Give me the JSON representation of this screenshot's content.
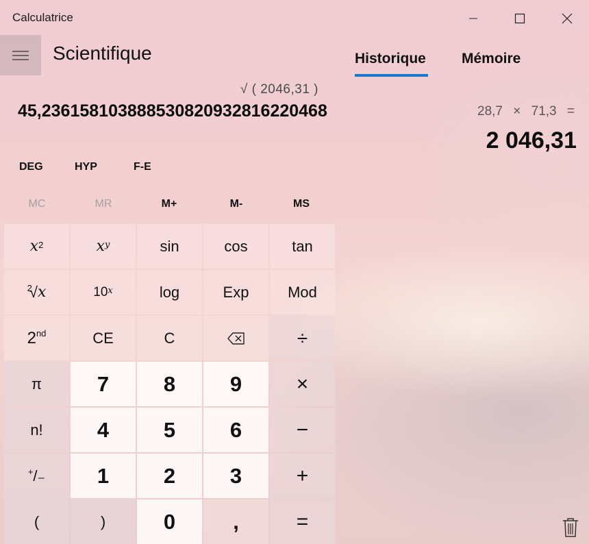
{
  "window": {
    "title": "Calculatrice",
    "minimize_icon": "minimize-icon",
    "maximize_icon": "maximize-icon",
    "close_icon": "close-icon"
  },
  "header": {
    "menu_icon": "hamburger-icon",
    "mode": "Scientifique"
  },
  "display": {
    "expression": "√ ( 2046,31 )",
    "result": "45,236158103888530820932816220468"
  },
  "angle_row": {
    "deg": "DEG",
    "hyp": "HYP",
    "fe": "F-E"
  },
  "memory": {
    "mc": "MC",
    "mr": "MR",
    "mplus": "M+",
    "mminus": "M-",
    "ms": "MS"
  },
  "keys": {
    "square": {
      "base": "x",
      "exp": "2"
    },
    "power": {
      "base": "x",
      "exp": "y"
    },
    "sin": "sin",
    "cos": "cos",
    "tan": "tan",
    "sqrt": {
      "index": "2",
      "radical": "√",
      "base": "x"
    },
    "ten_power": {
      "base": "10",
      "exp": "x"
    },
    "log": "log",
    "exp": "Exp",
    "mod": "Mod",
    "second": {
      "base": "2",
      "exp": "nd"
    },
    "ce": "CE",
    "c": "C",
    "backspace_icon": "backspace-icon",
    "divide": "÷",
    "pi": "π",
    "seven": "7",
    "eight": "8",
    "nine": "9",
    "multiply": "×",
    "factorial": "n!",
    "four": "4",
    "five": "5",
    "six": "6",
    "minus": "−",
    "negate": {
      "plus": "+",
      "minus": "/₋"
    },
    "one": "1",
    "two": "2",
    "three": "3",
    "plus": "+",
    "open_paren": "(",
    "close_paren": ")",
    "zero": "0",
    "decimal": ",",
    "equals": "="
  },
  "panel": {
    "tab_history": "Historique",
    "tab_memory": "Mémoire",
    "active_tab": "Historique",
    "history": [
      {
        "expression": "28,7 × 71,3 =",
        "result": "2 046,31"
      }
    ],
    "trash_icon": "trash-icon"
  },
  "colors": {
    "accent": "#1b78c8"
  }
}
